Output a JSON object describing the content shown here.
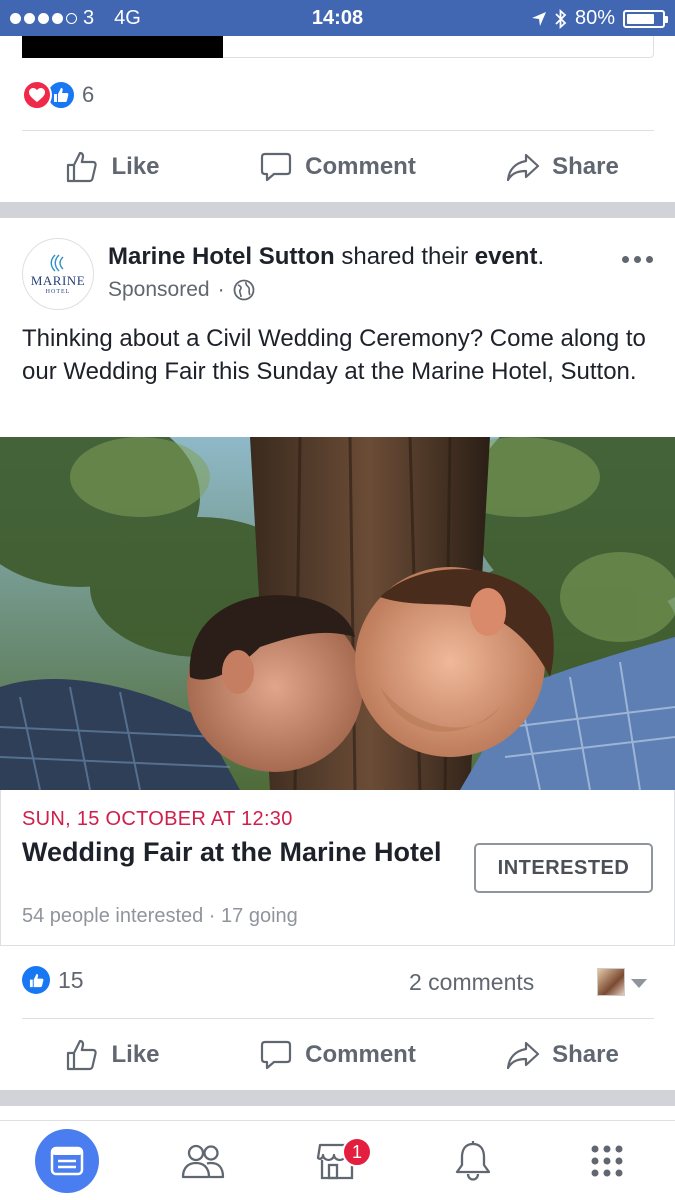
{
  "status_bar": {
    "carrier": "3",
    "network": "4G",
    "time": "14:08",
    "battery": "80%",
    "battery_level": 0.8
  },
  "previous_post": {
    "reaction_count": "6",
    "actions": {
      "like": "Like",
      "comment": "Comment",
      "share": "Share"
    }
  },
  "sponsored_post": {
    "page_name": "Marine Hotel Sutton",
    "header_middle": " shared their ",
    "header_object": "event",
    "header_end": ".",
    "sponsored_label": "Sponsored",
    "meta_separator": "·",
    "avatar_text": "MARINE",
    "avatar_subtext": "HOTEL",
    "body_text": "Thinking about a Civil Wedding Ceremony? Come along to our Wedding Fair this Sunday at the Marine Hotel, Sutton.",
    "event": {
      "date": "SUN, 15 OCTOBER AT 12:30",
      "title": "Wedding Fair at the Marine Hotel",
      "stats": "54 people interested · 17 going",
      "button_label": "INTERESTED"
    },
    "likes_count": "15",
    "comments_count": "2 comments",
    "actions": {
      "like": "Like",
      "comment": "Comment",
      "share": "Share"
    }
  },
  "tab_bar": {
    "marketplace_badge": "1"
  },
  "colors": {
    "brand_blue": "#4267b2",
    "event_date_red": "#cf1f4a",
    "like_blue": "#1877f2",
    "love_red": "#f0284a"
  }
}
